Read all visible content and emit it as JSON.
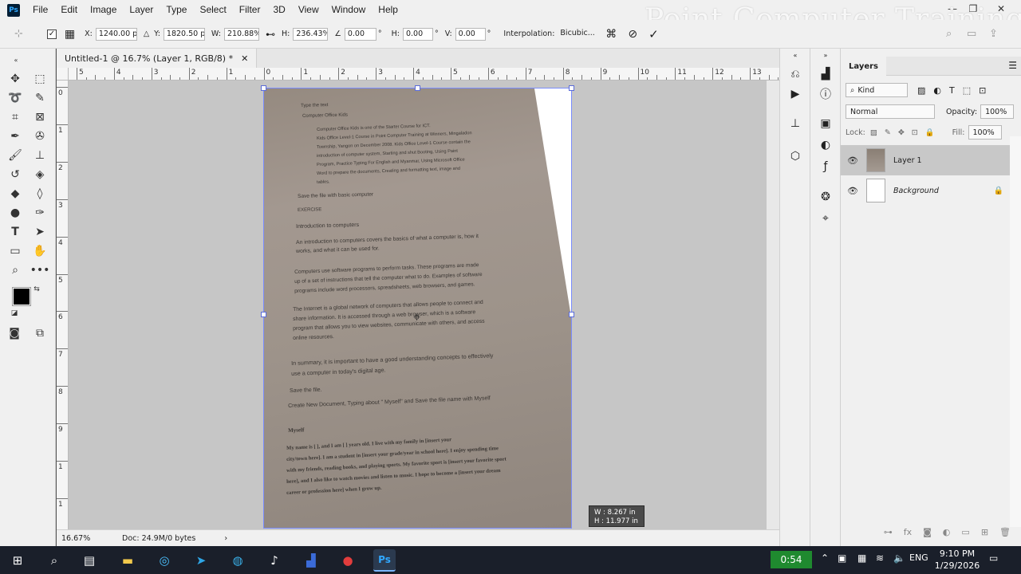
{
  "app": {
    "logo": "Ps",
    "watermark": "Point Computer Training",
    "menu": [
      "File",
      "Edit",
      "Image",
      "Layer",
      "Type",
      "Select",
      "Filter",
      "3D",
      "View",
      "Window",
      "Help"
    ],
    "window_buttons": [
      "—",
      "❐",
      "✕"
    ]
  },
  "options_bar": {
    "x_label": "X:",
    "x_value": "1240.00 p:",
    "y_label": "Y:",
    "y_value": "1820.50 p:",
    "w_label": "W:",
    "w_value": "210.88%",
    "h_label": "H:",
    "h_value": "236.43%",
    "angle_value": "0.00",
    "angle_unit": "°",
    "hskew_label": "H:",
    "hskew_value": "0.00",
    "vskew_label": "V:",
    "vskew_value": "0.00",
    "interp_label": "Interpolation:",
    "interp_value": "Bicubic..."
  },
  "document": {
    "tab_title": "Untitled-1 @ 16.7% (Layer 1, RGB/8) *",
    "zoom": "16.67%",
    "doc_info": "Doc: 24.9M/0 bytes",
    "ruler_top": [
      "5",
      "4",
      "3",
      "2",
      "1",
      "0",
      "1",
      "2",
      "3",
      "4",
      "5",
      "6",
      "7",
      "8",
      "9",
      "10",
      "11",
      "12",
      "13"
    ],
    "ruler_left": [
      "0",
      "1",
      "2",
      "3",
      "4",
      "5",
      "6",
      "7",
      "8",
      "9",
      "1",
      "1"
    ],
    "size_tip_w": "W :   8.267 in",
    "size_tip_h": "H :   11.977 in"
  },
  "photo_text": {
    "title": "Type the text",
    "subtitle": "Computer Office Kids",
    "para1": [
      "Computer Office Kids is one of the Starter Course for ICT.",
      "Kids Office Level-1 Course in Point Computer Training at Winners, Mingaladon",
      "Township, Yangon on December 2008. Kids Office Level-1 Course contain the",
      "introduction of computer system, Starting and shut Booting, Using Paint",
      "Program, Practice Typing For English and Myanmar, Using Microsoft Office",
      "Word to prepare the documents, Creating and formatting text, image and",
      "tables."
    ],
    "save_basic": "Save the file with basic computer",
    "exercise": "EXERCISE",
    "intro": "Introduction to computers",
    "para2": [
      "An introduction to computers covers the basics of what a computer is, how it",
      "works, and what it can be used for."
    ],
    "para3": [
      "Computers use software programs to perform tasks. These programs are made",
      "up of a set of instructions that tell the computer what to do. Examples of software",
      "programs include word processors, spreadsheets, web browsers, and games."
    ],
    "para4": [
      "The Internet is a global network of computers that allows people to connect and",
      "share information. It is accessed through a web browser, which is a software",
      "program that allows you to view websites, communicate with others, and access",
      "online resources."
    ],
    "para5": [
      "In summary, it is important to have a good understanding concepts to effectively",
      "use a computer in today's digital age."
    ],
    "save_file": "Save the file.",
    "create_doc": "Create New Document, Typing about \" Myself\" and Save the file name with Myself",
    "myself": "Myself",
    "para6": [
      "My name is [            ], and I am [            ] years old. I live with my family in [insert your",
      "city/town here]. I am a student in [insert your grade/year in school here]. I enjoy spending time",
      "with my friends, reading books, and playing sports. My favorite sport is [insert your favorite sport",
      "here], and I also like to watch movies and listen to music. I hope to become a [insert your dream",
      "career or profession here] when I grow up."
    ]
  },
  "layers_panel": {
    "tab": "Layers",
    "filter_kind": "Kind",
    "blend_mode": "Normal",
    "opacity_label": "Opacity:",
    "opacity_value": "100%",
    "lock_label": "Lock:",
    "fill_label": "Fill:",
    "fill_value": "100%",
    "layers": [
      {
        "name": "Layer 1",
        "selected": true
      },
      {
        "name": "Background",
        "selected": false
      }
    ]
  },
  "taskbar": {
    "timer": "0:54",
    "lang": "ENG",
    "time": "9:10 PM",
    "date": "1/29/2026"
  },
  "colors": {
    "accent_selection": "#7a8cff",
    "ps_brand": "#31a8ff",
    "timer_green": "#1f8a2f"
  }
}
